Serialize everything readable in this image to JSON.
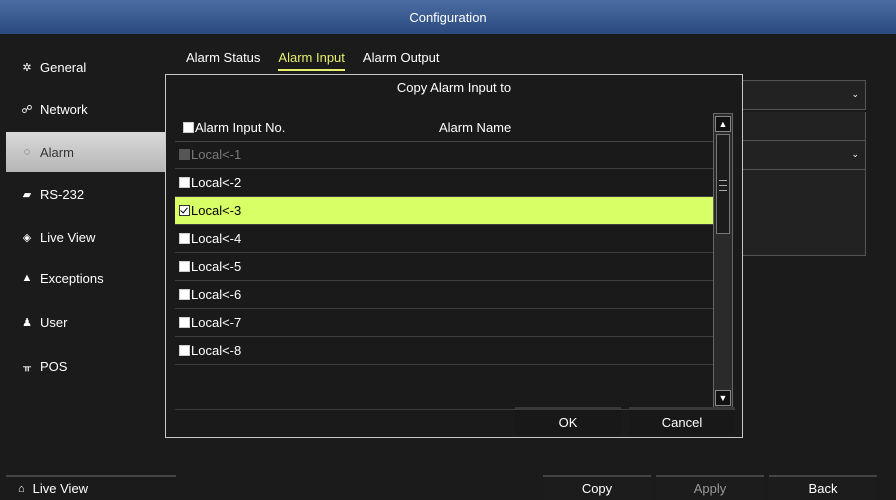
{
  "window": {
    "title": "Configuration"
  },
  "sidebar": {
    "items": [
      {
        "label": "General",
        "icon": "gear-icon",
        "active": false
      },
      {
        "label": "Network",
        "icon": "network-icon",
        "active": false
      },
      {
        "label": "Alarm",
        "icon": "alarm-icon",
        "active": true
      },
      {
        "label": "RS-232",
        "icon": "rs232-icon",
        "active": false
      },
      {
        "label": "Live View",
        "icon": "eye-icon",
        "active": false
      },
      {
        "label": "Exceptions",
        "icon": "warning-icon",
        "active": false
      },
      {
        "label": "User",
        "icon": "user-icon",
        "active": false
      },
      {
        "label": "POS",
        "icon": "pos-icon",
        "active": false
      }
    ],
    "live_view_label": "Live View"
  },
  "tabs": [
    {
      "label": "Alarm Status",
      "active": false
    },
    {
      "label": "Alarm Input",
      "active": true
    },
    {
      "label": "Alarm Output",
      "active": false
    }
  ],
  "dialog": {
    "title": "Copy Alarm Input to",
    "columns": {
      "no": "Alarm Input No.",
      "name": "Alarm Name"
    },
    "rows": [
      {
        "no": "Local<-1",
        "name": "",
        "checked": false,
        "disabled": true
      },
      {
        "no": "Local<-2",
        "name": "",
        "checked": false,
        "disabled": false
      },
      {
        "no": "Local<-3",
        "name": "",
        "checked": true,
        "disabled": false
      },
      {
        "no": "Local<-4",
        "name": "",
        "checked": false,
        "disabled": false
      },
      {
        "no": "Local<-5",
        "name": "",
        "checked": false,
        "disabled": false
      },
      {
        "no": "Local<-6",
        "name": "",
        "checked": false,
        "disabled": false
      },
      {
        "no": "Local<-7",
        "name": "",
        "checked": false,
        "disabled": false
      },
      {
        "no": "Local<-8",
        "name": "",
        "checked": false,
        "disabled": false
      }
    ],
    "ok_label": "OK",
    "cancel_label": "Cancel"
  },
  "footer": {
    "copy_label": "Copy",
    "apply_label": "Apply",
    "back_label": "Back"
  },
  "colors": {
    "titlebar": "#3a5b91",
    "selected_row": "#d9ff66",
    "active_tab": "#e6ef6e",
    "active_sidebar": "#c8c8c8"
  }
}
